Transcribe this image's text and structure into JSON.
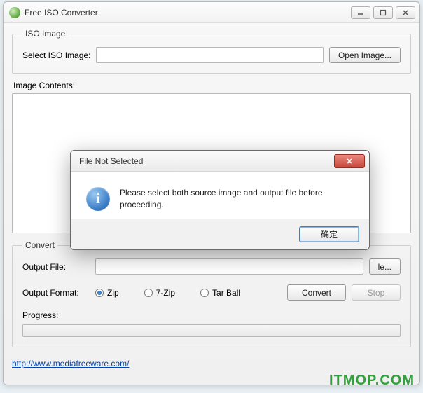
{
  "titlebar": {
    "title": "Free ISO Converter"
  },
  "iso_group": {
    "legend": "ISO Image",
    "select_label": "Select ISO Image:",
    "input_value": "",
    "open_button": "Open Image..."
  },
  "contents_label": "Image Contents:",
  "convert_group": {
    "legend": "Convert",
    "output_file_label": "Output File:",
    "output_file_value": "",
    "output_file_button_tail": "le...",
    "format_label": "Output Format:",
    "formats": {
      "zip": "Zip",
      "sevenzip": "7-Zip",
      "tarball": "Tar Ball"
    },
    "selected_format": "zip",
    "convert_button": "Convert",
    "stop_button": "Stop",
    "progress_label": "Progress:"
  },
  "link": {
    "text": "http://www.mediafreeware.com/",
    "href": "http://www.mediafreeware.com/"
  },
  "modal": {
    "title": "File Not Selected",
    "message": "Please select both source image and output file before proceeding.",
    "ok_button": "确定"
  },
  "watermark": "ITMOP.COM"
}
